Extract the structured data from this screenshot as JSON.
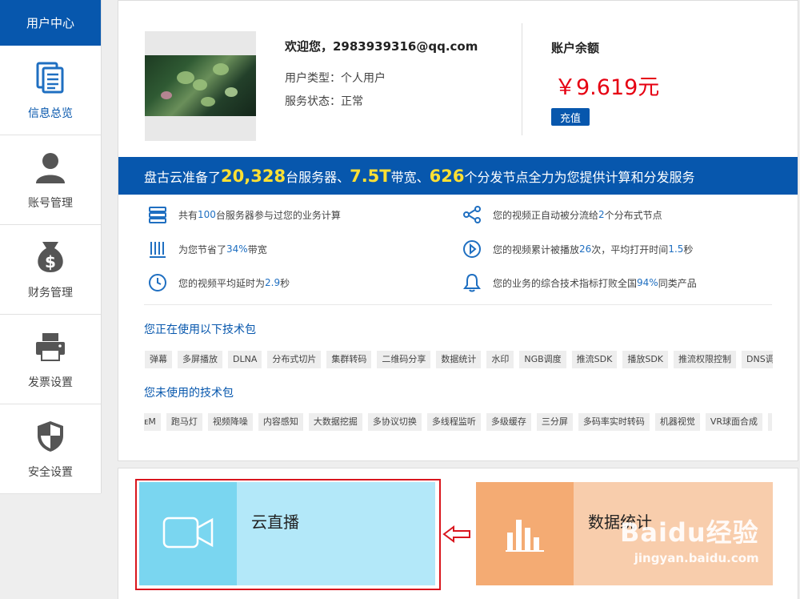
{
  "sidebar": {
    "header": "用户中心",
    "items": [
      {
        "label": "信息总览",
        "icon": "document-icon"
      },
      {
        "label": "账号管理",
        "icon": "user-icon"
      },
      {
        "label": "财务管理",
        "icon": "money-bag-icon"
      },
      {
        "label": "发票设置",
        "icon": "printer-icon"
      },
      {
        "label": "安全设置",
        "icon": "shield-icon"
      }
    ]
  },
  "account": {
    "welcome": "欢迎您，2983939316@qq.com",
    "user_type": "用户类型：个人用户",
    "service_status": "服务状态：正常",
    "balance_title": "账户余额",
    "balance_value": "￥9.619元",
    "recharge_label": "充值"
  },
  "banner": {
    "p1": "盘古云准备了",
    "n1": "20,328",
    "p2": "台服务器、",
    "n2": "7.5T",
    "p3": "带宽、",
    "n3": "626",
    "p4": "个分发节点全力为您提供计算和分发服务"
  },
  "stats": [
    {
      "icon": "server-icon",
      "pre": "共有",
      "hl": "100",
      "post": "台服务器参与过您的业务计算"
    },
    {
      "icon": "nodes-icon",
      "pre": "您的视频正自动被分流给",
      "hl": "2",
      "post": "个分布式节点"
    },
    {
      "icon": "bandwidth-icon",
      "pre": "为您节省了",
      "hl": "34%",
      "post": "带宽"
    },
    {
      "icon": "play-icon",
      "pre": "您的视频累计被播放",
      "hl": "26",
      "post": "次，平均打开时间",
      "hl2": "1.5",
      "post2": "秒"
    },
    {
      "icon": "clock-icon",
      "pre": "您的视频平均延时为",
      "hl": "2.9",
      "post": "秒"
    },
    {
      "icon": "bell-icon",
      "pre": "您的业务的综合技术指标打败全国",
      "hl": "94%",
      "post": "同类产品"
    }
  ],
  "used_packages": {
    "title": "您正在使用以下技术包",
    "tags": [
      "弹幕",
      "多屏播放",
      "DLNA",
      "分布式切片",
      "集群转码",
      "二维码分享",
      "数据统计",
      "水印",
      "NGB调度",
      "推流SDK",
      "播放SDK",
      "推流权限控制",
      "DNS调"
    ]
  },
  "unused_packages": {
    "title": "您未使用的技术包",
    "tags": [
      "ᴇM",
      "跑马灯",
      "视频降噪",
      "内容感知",
      "大数据挖掘",
      "多协议切换",
      "多线程监听",
      "多级缓存",
      "三分屏",
      "多码率实时转码",
      "机器视觉",
      "VR球面合成",
      "B"
    ]
  },
  "tiles": {
    "live": {
      "label": "云直播",
      "icon": "video-camera-icon",
      "color": "#7ad6f0"
    },
    "stats": {
      "label": "数据统计",
      "icon": "bar-chart-icon",
      "color": "#f4ab73"
    }
  },
  "watermark": {
    "line1": "Baidu经验",
    "line2": "jingyan.baidu.com"
  }
}
